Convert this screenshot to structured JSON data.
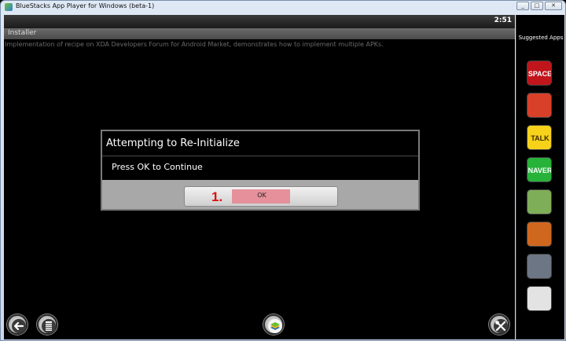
{
  "window": {
    "title": "BlueStacks App Player for Windows (beta-1)",
    "controls": [
      "_",
      "□",
      "✕"
    ]
  },
  "statusbar": {
    "time": "2:51"
  },
  "app": {
    "title": "Installer",
    "description": "Implementation of recipe on XDA Developers Forum for Android Market, demonstrates how to implement multiple APKs."
  },
  "dialog": {
    "title": "Attempting to Re-Initialize",
    "message": "Press OK to Continue",
    "ok_label": "OK",
    "step_annotation": "1."
  },
  "bottom_nav": {
    "back": "back-icon",
    "menu": "menu-icon",
    "home": "bluestacks-home-icon",
    "settings": "settings-tools-icon"
  },
  "sidebar": {
    "title": "Suggested Apps",
    "apps": [
      {
        "icon": "angry-birds-space-icon",
        "text": "SPACE",
        "color": "#c0151b"
      },
      {
        "icon": "angry-birds-icon",
        "text": "",
        "color": "#d8402a"
      },
      {
        "icon": "kakaotalk-icon",
        "text": "TALK",
        "color": "#f7d21a"
      },
      {
        "icon": "naver-icon",
        "text": "NAVER",
        "color": "#27b23a"
      },
      {
        "icon": "green-app-icon",
        "text": "",
        "color": "#7fae58"
      },
      {
        "icon": "game-app-icon",
        "text": "",
        "color": "#d0671f"
      },
      {
        "icon": "city-game-icon",
        "text": "",
        "color": "#6d7684"
      },
      {
        "icon": "orange-app-icon",
        "text": "",
        "color": "#e3e3e3"
      }
    ]
  }
}
